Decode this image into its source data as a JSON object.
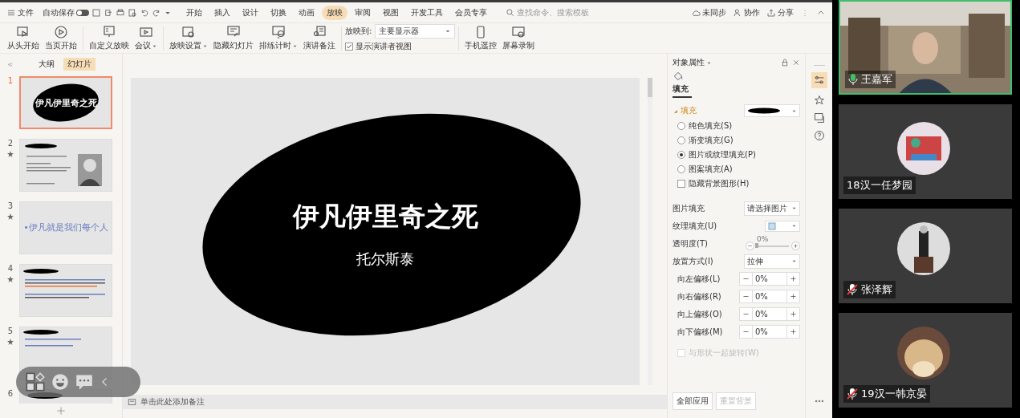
{
  "menu_bar": {
    "file": "文件",
    "autosave": {
      "label": "自动保存",
      "on": false
    },
    "tabs": [
      {
        "label": "开始",
        "selected": false
      },
      {
        "label": "插入",
        "selected": false
      },
      {
        "label": "设计",
        "selected": false
      },
      {
        "label": "切换",
        "selected": false
      },
      {
        "label": "动画",
        "selected": false
      },
      {
        "label": "放映",
        "selected": true
      },
      {
        "label": "审阅",
        "selected": false
      },
      {
        "label": "视图",
        "selected": false
      },
      {
        "label": "开发工具",
        "selected": false
      },
      {
        "label": "会员专享",
        "selected": false
      }
    ],
    "search": {
      "placeholder": "查找命令、搜索模板"
    },
    "actions": [
      "未同步",
      "协作",
      "分享"
    ]
  },
  "ribbon": {
    "buttons": [
      {
        "label": "从头开始",
        "dropdown": false
      },
      {
        "label": "当页开始",
        "dropdown": false
      },
      {
        "label": "自定义放映",
        "dropdown": false
      },
      {
        "label": "会议",
        "dropdown": true
      },
      {
        "label": "放映设置",
        "dropdown": true
      },
      {
        "label": "隐藏幻灯片",
        "dropdown": false
      },
      {
        "label": "排练计时",
        "dropdown": true
      },
      {
        "label": "演讲备注",
        "dropdown": false
      }
    ],
    "show_on": {
      "label": "放映到:",
      "value": "主要显示器"
    },
    "presenter_view": {
      "label": "显示演讲者视图",
      "checked": true
    },
    "extra_buttons": [
      {
        "label": "手机遥控"
      },
      {
        "label": "屏幕录制"
      }
    ]
  },
  "slide_panel": {
    "tabs": [
      {
        "label": "大纲",
        "selected": false
      },
      {
        "label": "幻灯片",
        "selected": true
      }
    ],
    "slides": [
      {
        "number": "1",
        "selected": true,
        "animated": false,
        "kind": "title",
        "title": "伊凡伊里奇之死"
      },
      {
        "number": "2",
        "selected": false,
        "animated": true
      },
      {
        "number": "3",
        "selected": false,
        "animated": true,
        "kind": "text",
        "text": "•伊凡就是我们每个人"
      },
      {
        "number": "4",
        "selected": false,
        "animated": true,
        "kind": "bullets"
      },
      {
        "number": "5",
        "selected": false,
        "animated": true,
        "kind": "bullets"
      },
      {
        "number": "6",
        "selected": false,
        "animated": false,
        "kind": "partial"
      }
    ]
  },
  "slide": {
    "title": "伊凡伊里奇之死",
    "subtitle": "托尔斯泰"
  },
  "notes": {
    "placeholder": "单击此处添加备注"
  },
  "properties": {
    "title": "对象属性",
    "tab": "填充",
    "section": {
      "label": "填充",
      "expanded": true
    },
    "fill_options": [
      {
        "label": "纯色填充(S)",
        "selected": false
      },
      {
        "label": "渐变填充(G)",
        "selected": false
      },
      {
        "label": "图片或纹理填充(P)",
        "selected": true
      },
      {
        "label": "图案填充(A)",
        "selected": false
      }
    ],
    "hide_background": {
      "label": "隐藏背景图形(H)",
      "checked": false
    },
    "picture_fill": {
      "label": "图片填充",
      "value": "请选择图片"
    },
    "texture_fill": {
      "label": "纹理填充(U)"
    },
    "transparency": {
      "label": "透明度(T)",
      "reading": "0%",
      "level": 0
    },
    "placement": {
      "label": "放置方式(I)",
      "value": "拉伸"
    },
    "offsets": [
      {
        "label": "向左偏移(L)",
        "value": "0%"
      },
      {
        "label": "向右偏移(R)",
        "value": "0%"
      },
      {
        "label": "向上偏移(O)",
        "value": "0%"
      },
      {
        "label": "向下偏移(M)",
        "value": "0%"
      }
    ],
    "rotate_with_shape": {
      "label": "与形状一起旋转(W)",
      "checked": false,
      "disabled": true
    },
    "buttons": [
      {
        "label": "全部应用",
        "disabled": false
      },
      {
        "label": "重置背景",
        "disabled": true
      }
    ]
  },
  "participants": [
    {
      "name": "王嘉军",
      "muted": false,
      "speaking": true,
      "kind": "picture"
    },
    {
      "name": "18汉一任梦园",
      "speaking": false,
      "kind": "picture"
    },
    {
      "name": "张泽辉",
      "muted": true,
      "speaking": false,
      "kind": "picture"
    },
    {
      "name": "19汉一韩京晏",
      "muted": true,
      "speaking": false,
      "kind": "picture"
    }
  ]
}
